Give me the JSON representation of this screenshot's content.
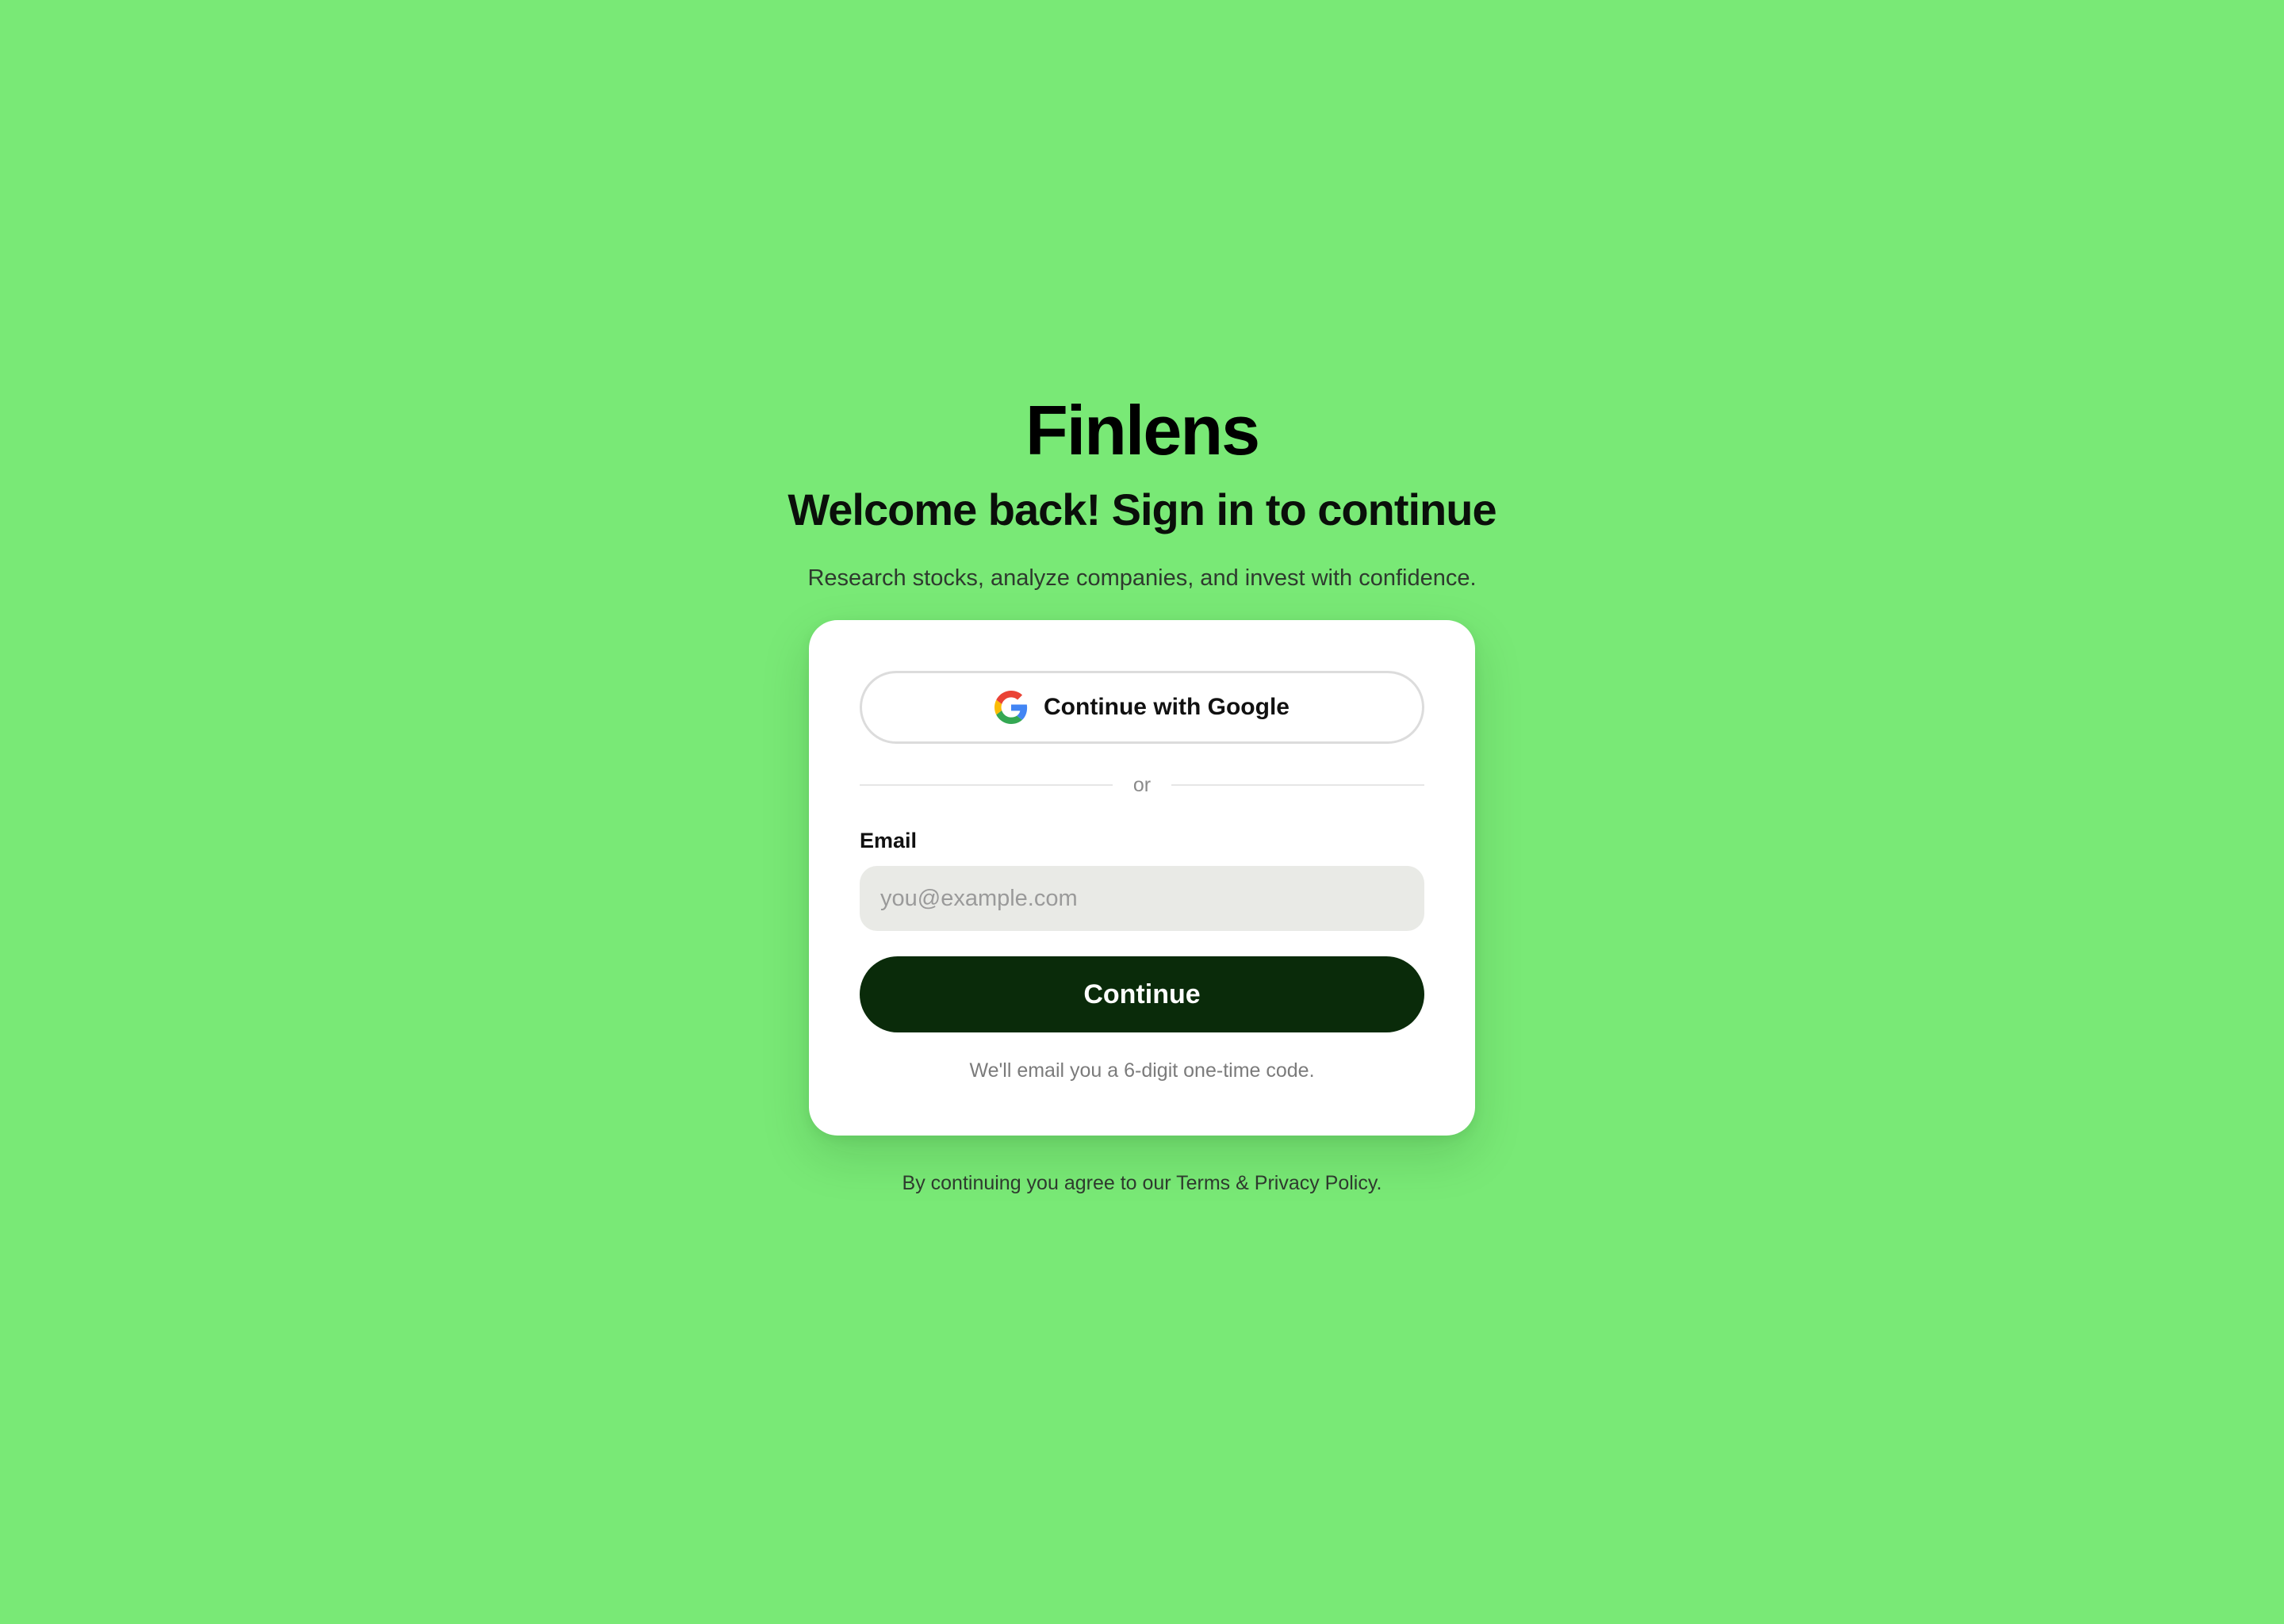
{
  "app": {
    "brand": "Finlens",
    "background_color": "#79e976",
    "accent_color": "#0a2b0a"
  },
  "hero": {
    "headline": "Welcome back! Sign in to continue",
    "tagline": "Research stocks, analyze companies, and invest with confidence."
  },
  "card": {
    "google_button": {
      "label": "Continue with Google",
      "icon": "google-g-icon"
    },
    "divider_text": "or",
    "email": {
      "label": "Email",
      "placeholder": "you@example.com",
      "value": ""
    },
    "continue_button": {
      "label": "Continue"
    },
    "hint": "We'll email you a 6-digit one-time code."
  },
  "footer": {
    "prefix": "By continuing you agree to our ",
    "terms_link": "Terms",
    "and": " & ",
    "privacy_link": "Privacy Policy",
    "suffix": "."
  }
}
